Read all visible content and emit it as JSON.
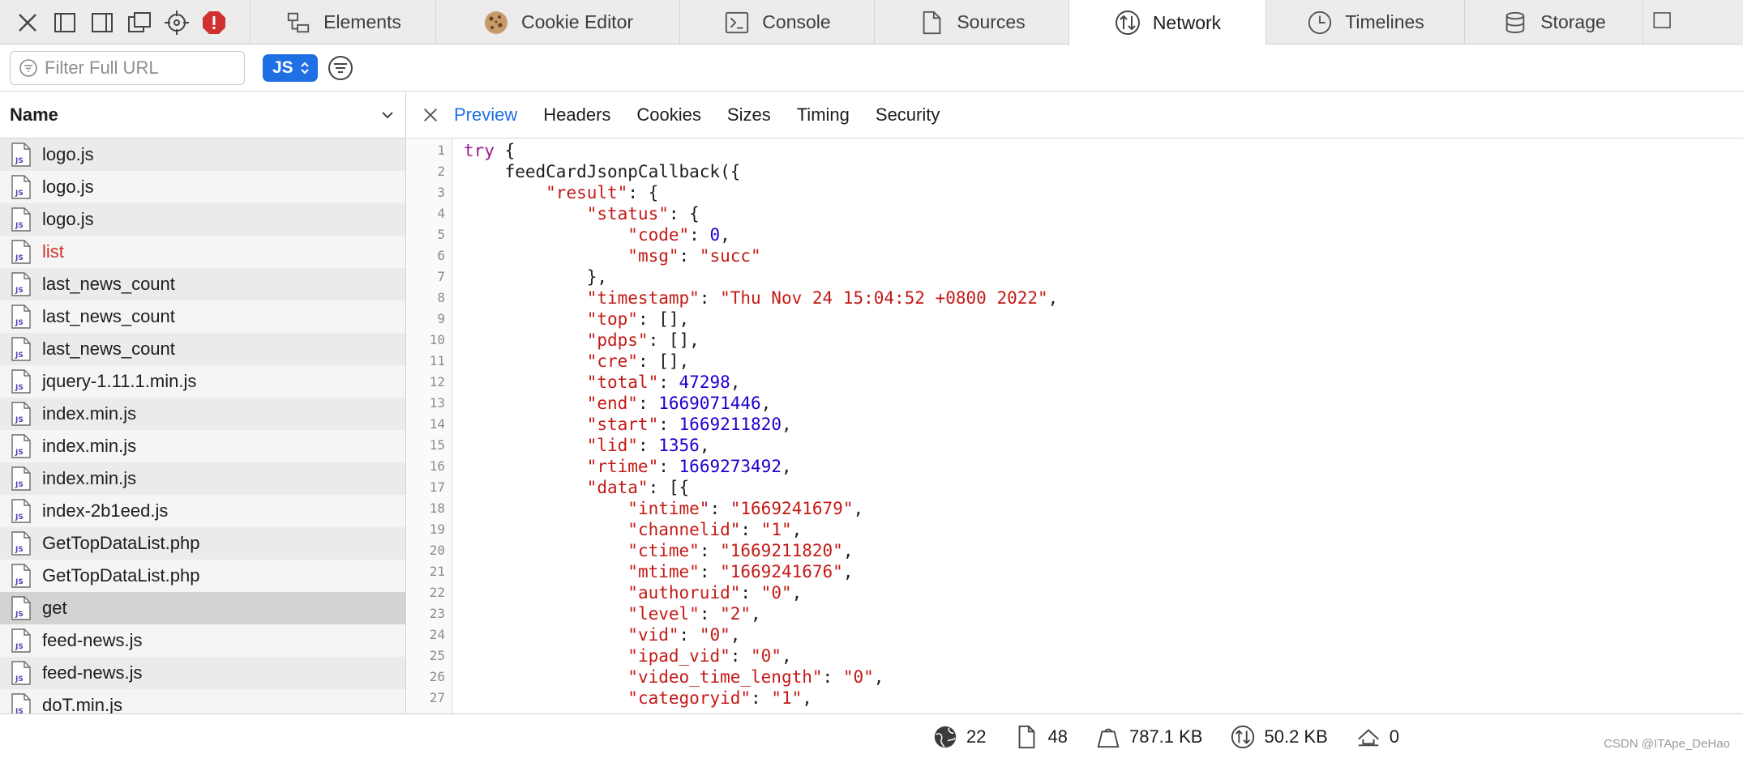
{
  "tabs": [
    {
      "label": "Elements",
      "icon": "elements-icon"
    },
    {
      "label": "Cookie Editor",
      "icon": "cookie-icon"
    },
    {
      "label": "Console",
      "icon": "console-icon"
    },
    {
      "label": "Sources",
      "icon": "sources-icon"
    },
    {
      "label": "Network",
      "icon": "network-icon",
      "active": true
    },
    {
      "label": "Timelines",
      "icon": "timelines-icon"
    },
    {
      "label": "Storage",
      "icon": "storage-icon"
    }
  ],
  "filter": {
    "placeholder": "Filter Full URL",
    "type_selected": "JS"
  },
  "list": {
    "header": "Name",
    "rows": [
      {
        "label": "logo.js"
      },
      {
        "label": "logo.js"
      },
      {
        "label": "logo.js"
      },
      {
        "label": "list",
        "error": true
      },
      {
        "label": "last_news_count"
      },
      {
        "label": "last_news_count"
      },
      {
        "label": "last_news_count"
      },
      {
        "label": "jquery-1.11.1.min.js"
      },
      {
        "label": "index.min.js"
      },
      {
        "label": "index.min.js"
      },
      {
        "label": "index.min.js"
      },
      {
        "label": "index-2b1eed.js"
      },
      {
        "label": "GetTopDataList.php"
      },
      {
        "label": "GetTopDataList.php"
      },
      {
        "label": "get",
        "selected": true
      },
      {
        "label": "feed-news.js"
      },
      {
        "label": "feed-news.js"
      },
      {
        "label": "doT.min.js"
      }
    ]
  },
  "detail_tabs": [
    "Preview",
    "Headers",
    "Cookies",
    "Sizes",
    "Timing",
    "Security"
  ],
  "code_lines": [
    [
      [
        "kw",
        "try"
      ],
      [
        "p",
        " {"
      ]
    ],
    [
      [
        "p",
        "    feedCardJsonpCallback({"
      ]
    ],
    [
      [
        "p",
        "        "
      ],
      [
        "str",
        "\"result\""
      ],
      [
        "p",
        ": {"
      ]
    ],
    [
      [
        "p",
        "            "
      ],
      [
        "str",
        "\"status\""
      ],
      [
        "p",
        ": {"
      ]
    ],
    [
      [
        "p",
        "                "
      ],
      [
        "str",
        "\"code\""
      ],
      [
        "p",
        ": "
      ],
      [
        "num",
        "0"
      ],
      [
        "p",
        ","
      ]
    ],
    [
      [
        "p",
        "                "
      ],
      [
        "str",
        "\"msg\""
      ],
      [
        "p",
        ": "
      ],
      [
        "str",
        "\"succ\""
      ]
    ],
    [
      [
        "p",
        "            },"
      ]
    ],
    [
      [
        "p",
        "            "
      ],
      [
        "str",
        "\"timestamp\""
      ],
      [
        "p",
        ": "
      ],
      [
        "str",
        "\"Thu Nov 24 15:04:52 +0800 2022\""
      ],
      [
        "p",
        ","
      ]
    ],
    [
      [
        "p",
        "            "
      ],
      [
        "str",
        "\"top\""
      ],
      [
        "p",
        ": [],"
      ]
    ],
    [
      [
        "p",
        "            "
      ],
      [
        "str",
        "\"pdps\""
      ],
      [
        "p",
        ": [],"
      ]
    ],
    [
      [
        "p",
        "            "
      ],
      [
        "str",
        "\"cre\""
      ],
      [
        "p",
        ": [],"
      ]
    ],
    [
      [
        "p",
        "            "
      ],
      [
        "str",
        "\"total\""
      ],
      [
        "p",
        ": "
      ],
      [
        "num",
        "47298"
      ],
      [
        "p",
        ","
      ]
    ],
    [
      [
        "p",
        "            "
      ],
      [
        "str",
        "\"end\""
      ],
      [
        "p",
        ": "
      ],
      [
        "num",
        "1669071446"
      ],
      [
        "p",
        ","
      ]
    ],
    [
      [
        "p",
        "            "
      ],
      [
        "str",
        "\"start\""
      ],
      [
        "p",
        ": "
      ],
      [
        "num",
        "1669211820"
      ],
      [
        "p",
        ","
      ]
    ],
    [
      [
        "p",
        "            "
      ],
      [
        "str",
        "\"lid\""
      ],
      [
        "p",
        ": "
      ],
      [
        "num",
        "1356"
      ],
      [
        "p",
        ","
      ]
    ],
    [
      [
        "p",
        "            "
      ],
      [
        "str",
        "\"rtime\""
      ],
      [
        "p",
        ": "
      ],
      [
        "num",
        "1669273492"
      ],
      [
        "p",
        ","
      ]
    ],
    [
      [
        "p",
        "            "
      ],
      [
        "str",
        "\"data\""
      ],
      [
        "p",
        ": [{"
      ]
    ],
    [
      [
        "p",
        "                "
      ],
      [
        "str",
        "\"intime\""
      ],
      [
        "p",
        ": "
      ],
      [
        "str",
        "\"1669241679\""
      ],
      [
        "p",
        ","
      ]
    ],
    [
      [
        "p",
        "                "
      ],
      [
        "str",
        "\"channelid\""
      ],
      [
        "p",
        ": "
      ],
      [
        "str",
        "\"1\""
      ],
      [
        "p",
        ","
      ]
    ],
    [
      [
        "p",
        "                "
      ],
      [
        "str",
        "\"ctime\""
      ],
      [
        "p",
        ": "
      ],
      [
        "str",
        "\"1669211820\""
      ],
      [
        "p",
        ","
      ]
    ],
    [
      [
        "p",
        "                "
      ],
      [
        "str",
        "\"mtime\""
      ],
      [
        "p",
        ": "
      ],
      [
        "str",
        "\"1669241676\""
      ],
      [
        "p",
        ","
      ]
    ],
    [
      [
        "p",
        "                "
      ],
      [
        "str",
        "\"authoruid\""
      ],
      [
        "p",
        ": "
      ],
      [
        "str",
        "\"0\""
      ],
      [
        "p",
        ","
      ]
    ],
    [
      [
        "p",
        "                "
      ],
      [
        "str",
        "\"level\""
      ],
      [
        "p",
        ": "
      ],
      [
        "str",
        "\"2\""
      ],
      [
        "p",
        ","
      ]
    ],
    [
      [
        "p",
        "                "
      ],
      [
        "str",
        "\"vid\""
      ],
      [
        "p",
        ": "
      ],
      [
        "str",
        "\"0\""
      ],
      [
        "p",
        ","
      ]
    ],
    [
      [
        "p",
        "                "
      ],
      [
        "str",
        "\"ipad_vid\""
      ],
      [
        "p",
        ": "
      ],
      [
        "str",
        "\"0\""
      ],
      [
        "p",
        ","
      ]
    ],
    [
      [
        "p",
        "                "
      ],
      [
        "str",
        "\"video_time_length\""
      ],
      [
        "p",
        ": "
      ],
      [
        "str",
        "\"0\""
      ],
      [
        "p",
        ","
      ]
    ],
    [
      [
        "p",
        "                "
      ],
      [
        "str",
        "\"categoryid\""
      ],
      [
        "p",
        ": "
      ],
      [
        "str",
        "\"1\""
      ],
      [
        "p",
        ","
      ]
    ]
  ],
  "status": {
    "domains": "22",
    "resources": "48",
    "size": "787.1 KB",
    "transferred": "50.2 KB",
    "redirects": "0"
  },
  "watermark": "CSDN @ITApe_DeHao",
  "colors": {
    "accent": "#1f6fe5",
    "error_text": "#d32f2f",
    "error_badge": "#d0302f",
    "string": "#c41a16",
    "number": "#1c00cf",
    "keyword": "#9b1d91"
  }
}
